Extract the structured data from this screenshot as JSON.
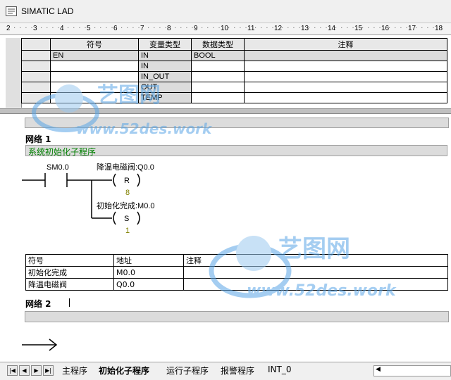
{
  "window": {
    "title": "SIMATIC LAD"
  },
  "ruler": {
    "ticks": [
      "2",
      "3",
      "4",
      "5",
      "6",
      "7",
      "8",
      "9",
      "10",
      "11",
      "12",
      "13",
      "14",
      "15",
      "16",
      "17",
      "18"
    ]
  },
  "var_table": {
    "headers": [
      "符号",
      "变量类型",
      "数据类型",
      "注释"
    ],
    "rows": [
      {
        "symbol": "EN",
        "var_type": "IN",
        "data_type": "BOOL",
        "comment": ""
      },
      {
        "symbol": "",
        "var_type": "IN",
        "data_type": "",
        "comment": ""
      },
      {
        "symbol": "",
        "var_type": "IN_OUT",
        "data_type": "",
        "comment": ""
      },
      {
        "symbol": "",
        "var_type": "OUT",
        "data_type": "",
        "comment": ""
      },
      {
        "symbol": "",
        "var_type": "TEMP",
        "data_type": "",
        "comment": ""
      }
    ]
  },
  "network1": {
    "title": "网络 1",
    "comment": "系统初始化子程序",
    "contact": {
      "label": "SM0.0"
    },
    "coil1": {
      "label": "降温电磁阀:Q0.0",
      "op": "R",
      "n": "8"
    },
    "coil2": {
      "label": "初始化完成:M0.0",
      "op": "S",
      "n": "1"
    }
  },
  "symbol_table": {
    "headers": [
      "符号",
      "地址",
      "注释"
    ],
    "rows": [
      {
        "symbol": "初始化完成",
        "address": "M0.0",
        "comment": ""
      },
      {
        "symbol": "降温电磁阀",
        "address": "Q0.0",
        "comment": ""
      }
    ]
  },
  "network2": {
    "title": "网络 2"
  },
  "tabs": [
    {
      "label": "主程序",
      "active": false
    },
    {
      "label": "初始化子程序",
      "active": true
    },
    {
      "label": "运行子程序",
      "active": false
    },
    {
      "label": "报警程序",
      "active": false
    },
    {
      "label": "INT_0",
      "active": false
    }
  ],
  "watermark": {
    "brand": "艺图网",
    "url": "www.52des.work"
  },
  "colors": {
    "comment_green": "#008000",
    "coil_number": "#808000",
    "grey_cell": "#dcdcdc"
  }
}
